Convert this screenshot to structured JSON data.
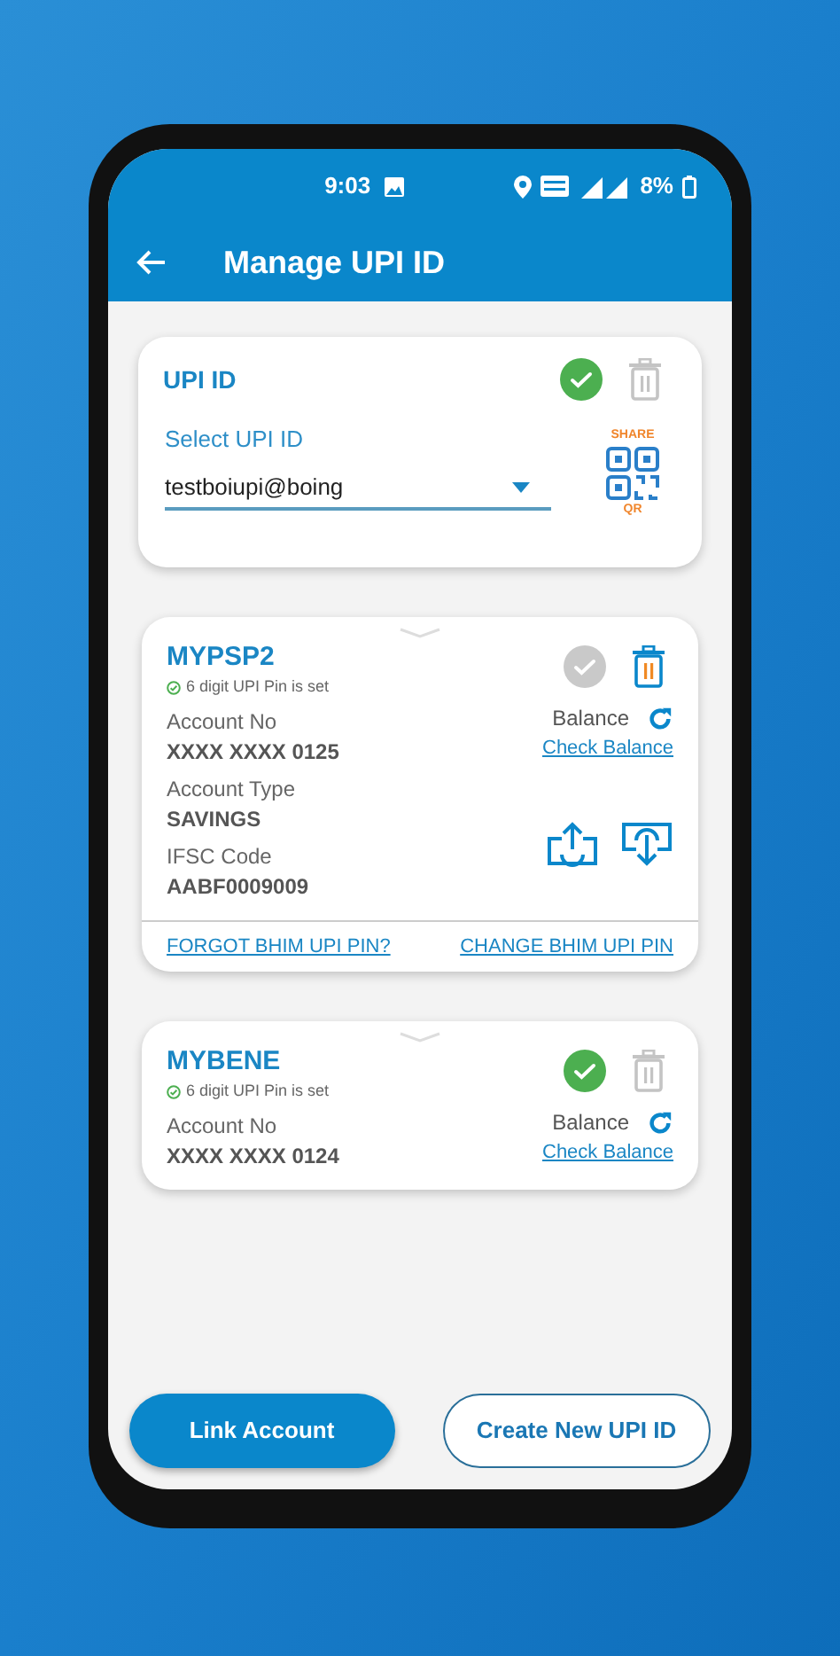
{
  "status_bar": {
    "time": "9:03",
    "battery": "8%"
  },
  "header": {
    "title": "Manage UPI ID"
  },
  "upi_card": {
    "title": "UPI ID",
    "primary": true,
    "deletable": false,
    "select_label": "Select UPI ID",
    "value": "testboiupi@boing",
    "share_top": "SHARE",
    "share_bottom": "QR"
  },
  "accounts": [
    {
      "name": "MYPSP2",
      "pin_status": "6 digit UPI Pin is set",
      "primary": false,
      "deletable": true,
      "fields": [
        {
          "label": "Account No",
          "value": "XXXX XXXX 0125"
        },
        {
          "label": "Account Type",
          "value": "SAVINGS"
        },
        {
          "label": "IFSC Code",
          "value": "AABF0009009"
        }
      ],
      "balance_label": "Balance",
      "check_balance": "Check Balance",
      "show_transfer_icons": true,
      "links": [
        "FORGOT BHIM UPI PIN?",
        "CHANGE BHIM UPI PIN"
      ]
    },
    {
      "name": "MYBENE",
      "pin_status": "6 digit UPI Pin is set",
      "primary": true,
      "deletable": false,
      "fields": [
        {
          "label": "Account No",
          "value": "XXXX XXXX 0124"
        }
      ],
      "balance_label": "Balance",
      "check_balance": "Check Balance",
      "show_transfer_icons": false
    }
  ],
  "buttons": [
    {
      "label": "Link Account",
      "kind": "filled"
    },
    {
      "label": "Create New UPI ID",
      "kind": "outline"
    }
  ]
}
